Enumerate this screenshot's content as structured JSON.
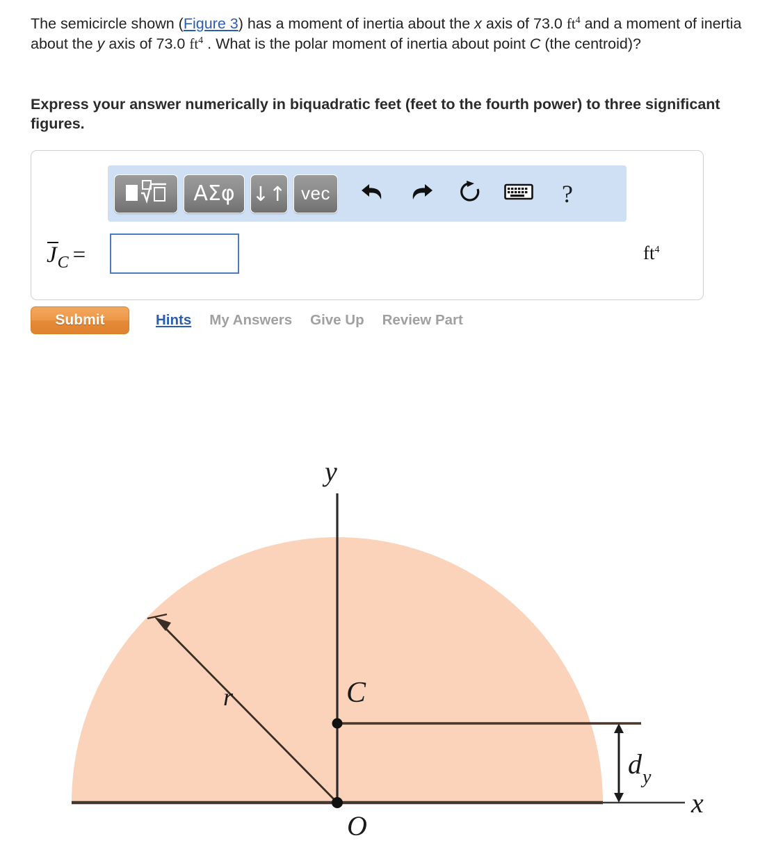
{
  "question": {
    "prefix": "The semicircle shown (",
    "figure_link": "Figure 3",
    "mid1": ") has a moment of inertia about the ",
    "axis_x": "x",
    "mid2": " axis of ",
    "ix_value": "73.0",
    "unit": "ft",
    "unit_exp": "4",
    "mid3": " and a moment of inertia about the ",
    "axis_y": "y",
    "mid4": " axis of ",
    "iy_value": "73.0",
    "mid5": ". What is the polar moment of inertia about point ",
    "point_c": "C",
    "suffix": " (the centroid)?"
  },
  "instruction": "Express your answer numerically in biquadratic feet (feet to the fourth power) to three significant figures.",
  "toolbar": {
    "template_button": "template-icon",
    "greek_button": "ΑΣφ",
    "arrows_button": "↓↑",
    "vec_button": "vec",
    "undo_icon": "undo-icon",
    "redo_icon": "redo-icon",
    "reset_icon": "reset-icon",
    "keyboard_icon": "keyboard-icon",
    "help_icon": "?"
  },
  "answer": {
    "variable": "J",
    "subscript": "C",
    "equals": "=",
    "value": "",
    "placeholder": "",
    "unit": "ft",
    "unit_exp": "4"
  },
  "actions": {
    "submit": "Submit",
    "hints": "Hints",
    "my_answers": "My Answers",
    "give_up": "Give Up",
    "review_part": "Review Part"
  },
  "figure": {
    "labels": {
      "y_axis": "y",
      "x_axis": "x",
      "origin": "O",
      "centroid": "C",
      "radius": "r",
      "distance": "d",
      "distance_sub": "y"
    },
    "colors": {
      "fill": "#fad3ba",
      "stroke": "#4a352b",
      "axis": "#2b2b2b"
    }
  },
  "colors": {
    "link": "#2a5db0",
    "submit_orange": "#ed9747",
    "toolbar_blue": "#cfe0f5",
    "input_border": "#4a7ebb",
    "dim_text": "#a0a0a0"
  }
}
